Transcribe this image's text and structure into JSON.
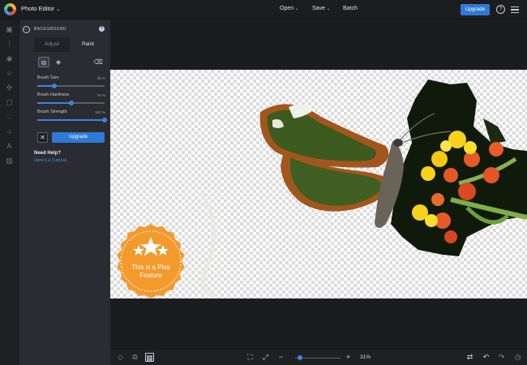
{
  "app": {
    "title": "Photo Editor"
  },
  "topbar": {
    "menus": [
      {
        "label": "Open"
      },
      {
        "label": "Save"
      },
      {
        "label": "Batch"
      }
    ],
    "upgrade_label": "Upgrade",
    "help_glyph": "?"
  },
  "rail": {
    "icons": [
      "image-icon",
      "sliders-icon",
      "eye-icon",
      "star-icon",
      "crop-icon",
      "frame-icon",
      "heart-icon",
      "circle-icon",
      "text-icon",
      "texture-icon"
    ]
  },
  "panel": {
    "title": "BACKGROUND",
    "tabs": [
      {
        "label": "Adjust"
      },
      {
        "label": "Paint"
      }
    ],
    "active_tab": "Paint",
    "sliders": [
      {
        "label": "Brush Size",
        "value_text": "35 %",
        "value": 0.25
      },
      {
        "label": "Brush Hardness",
        "value_text": "76 %",
        "value": 0.5
      },
      {
        "label": "Brush Strength",
        "value_text": "100 %",
        "value": 1.0
      }
    ],
    "apply_label": "Upgrade",
    "cancel_glyph": "✕",
    "help_title": "Need Help?",
    "help_link": "Here's a Tutorial"
  },
  "canvas": {
    "badge_line1": "This is a Plus",
    "badge_line2": "Feature"
  },
  "bottombar": {
    "zoom_minus": "−",
    "zoom_plus": "+",
    "zoom_value": "31%",
    "zoom_level": 0.05
  },
  "colors": {
    "accent": "#2f7ad6",
    "badge": "#f39a2d"
  }
}
